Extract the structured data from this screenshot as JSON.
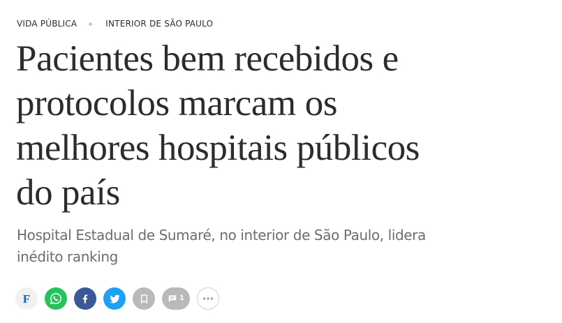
{
  "breadcrumb": {
    "section": "VIDA PÚBLICA",
    "subsection": "INTERIOR DE SÃO PAULO"
  },
  "article": {
    "headline": "Pacientes bem recebidos e protocolos marcam os melhores hospitais públicos do país",
    "subtitle": "Hospital Estadual de Sumaré, no interior de São Paulo, lidera inédito ranking"
  },
  "share": {
    "folha_label": "F",
    "comments_count": "1",
    "buttons": [
      {
        "icon": "folha-logo-icon",
        "color": "#f1f1f1"
      },
      {
        "icon": "whatsapp-icon",
        "color": "#25c35a"
      },
      {
        "icon": "facebook-icon",
        "color": "#3b5998"
      },
      {
        "icon": "twitter-icon",
        "color": "#1da1f2"
      },
      {
        "icon": "bookmark-icon",
        "color": "#b9b9b9"
      },
      {
        "icon": "comment-icon",
        "color": "#b9b9b9"
      },
      {
        "icon": "more-icon",
        "color": "#ffffff"
      }
    ]
  }
}
